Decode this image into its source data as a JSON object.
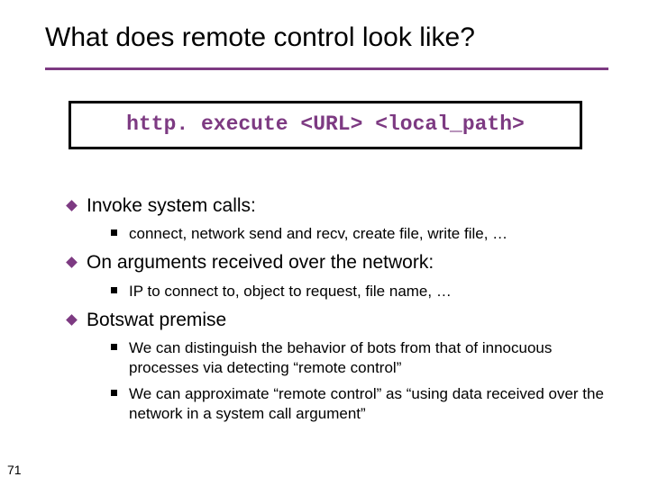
{
  "title": "What does remote control look like?",
  "command": "http. execute <URL> <local_path>",
  "bullets": {
    "b1": "Invoke system calls:",
    "b1_1": "connect, network send and recv, create file, write file, …",
    "b2": "On arguments received over the network:",
    "b2_1": "IP to connect to, object to request, file name, …",
    "b3": "Botswat premise",
    "b3_1": "We can distinguish the behavior of bots from that of innocuous processes via detecting “remote control”",
    "b3_2": "We can approximate “remote control” as “using data received over the network in a system call argument”"
  },
  "page_number": "71"
}
